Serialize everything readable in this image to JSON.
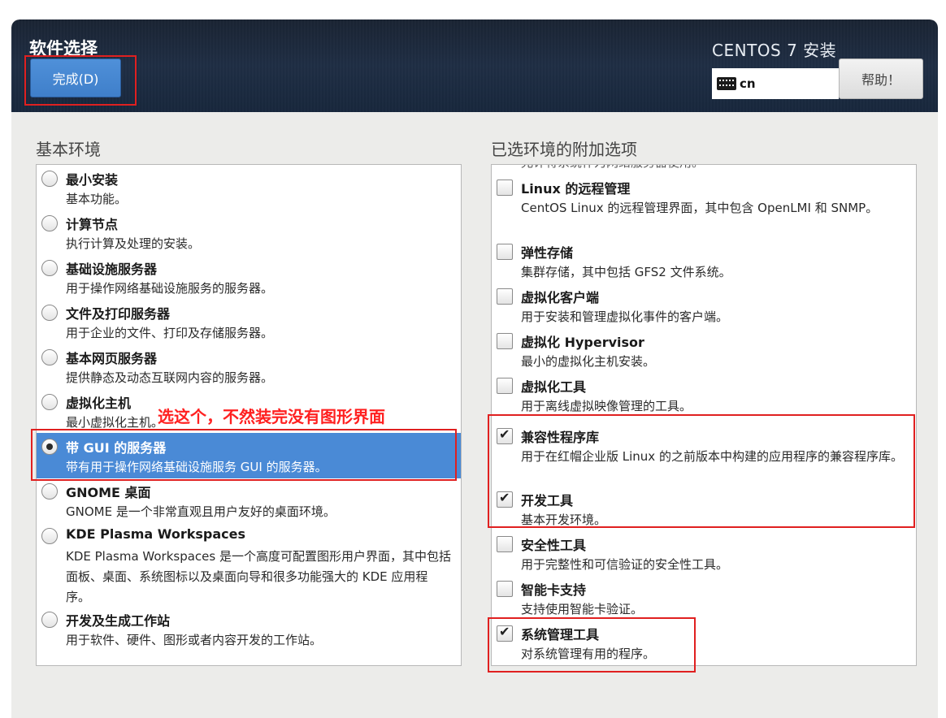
{
  "header": {
    "title": "软件选择",
    "done_label": "完成(D)",
    "install_title": "CENTOS 7 安装",
    "keyboard_layout": "cn",
    "help_label": "帮助！"
  },
  "left": {
    "label": "基本环境",
    "selected_index": 6,
    "items": [
      {
        "name": "最小安装",
        "desc": "基本功能。"
      },
      {
        "name": "计算节点",
        "desc": "执行计算及处理的安装。"
      },
      {
        "name": "基础设施服务器",
        "desc": "用于操作网络基础设施服务的服务器。"
      },
      {
        "name": "文件及打印服务器",
        "desc": "用于企业的文件、打印及存储服务器。"
      },
      {
        "name": "基本网页服务器",
        "desc": "提供静态及动态互联网内容的服务器。"
      },
      {
        "name": "虚拟化主机",
        "desc": "最小虚拟化主机。"
      },
      {
        "name": "带 GUI 的服务器",
        "desc": "带有用于操作网络基础设施服务 GUI 的服务器。"
      },
      {
        "name": "GNOME 桌面",
        "desc": "GNOME 是一个非常直观且用户友好的桌面环境。"
      },
      {
        "name": "KDE Plasma Workspaces",
        "desc": "KDE Plasma Workspaces 是一个高度可配置图形用户界面，其中包括面板、桌面、系统图标以及桌面向导和很多功能强大的 KDE 应用程序。"
      },
      {
        "name": "开发及生成工作站",
        "desc": "用于软件、硬件、图形或者内容开发的工作站。"
      }
    ]
  },
  "annotation": "选这个，不然装完没有图形界面",
  "right": {
    "label": "已选环境的附加选项",
    "cut_text": "允许将系统作为网络服务器使用。",
    "items": [
      {
        "name": "Linux 的远程管理",
        "desc": "CentOS Linux 的远程管理界面，其中包含 OpenLMI 和 SNMP。",
        "checked": false
      },
      {
        "name": "弹性存储",
        "desc": "集群存储，其中包括 GFS2 文件系统。",
        "checked": false
      },
      {
        "name": "虚拟化客户端",
        "desc": "用于安装和管理虚拟化事件的客户端。",
        "checked": false
      },
      {
        "name": "虚拟化 Hypervisor",
        "desc": "最小的虚拟化主机安装。",
        "checked": false
      },
      {
        "name": "虚拟化工具",
        "desc": "用于离线虚拟映像管理的工具。",
        "checked": false
      },
      {
        "name": "兼容性程序库",
        "desc": "用于在红帽企业版 Linux 的之前版本中构建的应用程序的兼容程序库。",
        "checked": true
      },
      {
        "name": "开发工具",
        "desc": "基本开发环境。",
        "checked": true
      },
      {
        "name": "安全性工具",
        "desc": "用于完整性和可信验证的安全性工具。",
        "checked": false
      },
      {
        "name": "智能卡支持",
        "desc": "支持使用智能卡验证。",
        "checked": false
      },
      {
        "name": "系统管理工具",
        "desc": "对系统管理有用的程序。",
        "checked": true
      }
    ]
  }
}
